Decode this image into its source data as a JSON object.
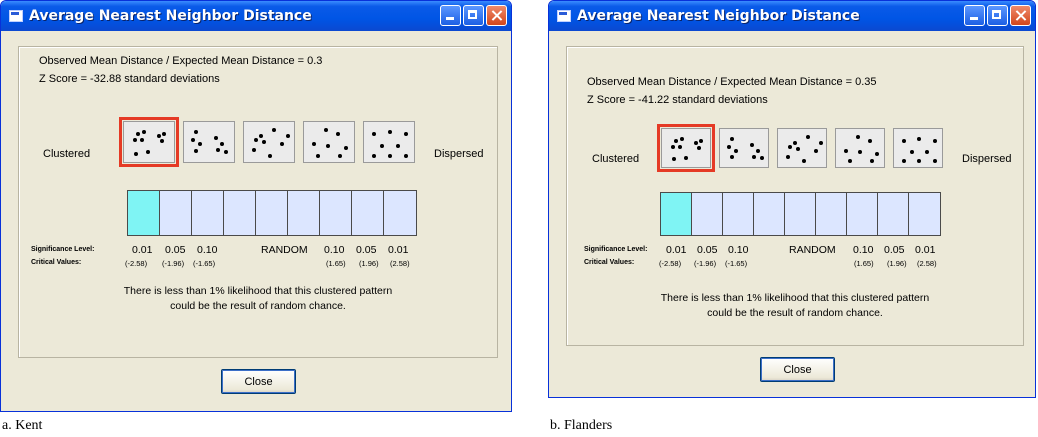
{
  "colors": {
    "selected_cell": "#7ff4f4",
    "cell": "#dce6ff",
    "highlight": "#e53a25",
    "titlebar": "#0055e5"
  },
  "panels": [
    {
      "window_title": "Average Nearest Neighbor Distance",
      "ratio_line": "Observed Mean Distance / Expected Mean Distance = 0.3",
      "z_line": "Z Score = -32.88 standard deviations",
      "clustered_label": "Clustered",
      "dispersed_label": "Dispersed",
      "significance_label": "Significance Level:",
      "critical_label": "Critical Values:",
      "sig_left": [
        "0.01",
        "0.05",
        "0.10"
      ],
      "crit_left": [
        "(-2.58)",
        "(-1.96)",
        "(-1.65)"
      ],
      "random_label": "RANDOM",
      "sig_right": [
        "0.10",
        "0.05",
        "0.01"
      ],
      "crit_right": [
        "(1.65)",
        "(1.96)",
        "(2.58)"
      ],
      "message_line1": "There is less than 1% likelihood that this clustered pattern",
      "message_line2": "could be the result of random chance.",
      "close_label": "Close",
      "selected_pattern_index": 0,
      "selected_cell_index": 0,
      "caption": "a. Kent",
      "titlebar_icons": [
        "minimize-icon",
        "maximize-icon",
        "close-icon"
      ]
    },
    {
      "window_title": "Average Nearest Neighbor Distance",
      "ratio_line": "Observed Mean Distance / Expected Mean Distance = 0.35",
      "z_line": "Z Score = -41.22 standard deviations",
      "clustered_label": "Clustered",
      "dispersed_label": "Dispersed",
      "significance_label": "Significance Level:",
      "critical_label": "Critical Values:",
      "sig_left": [
        "0.01",
        "0.05",
        "0.10"
      ],
      "crit_left": [
        "(-2.58)",
        "(-1.96)",
        "(-1.65)"
      ],
      "random_label": "RANDOM",
      "sig_right": [
        "0.10",
        "0.05",
        "0.01"
      ],
      "crit_right": [
        "(1.65)",
        "(1.96)",
        "(2.58)"
      ],
      "message_line1": "There is less than 1% likelihood that this clustered pattern",
      "message_line2": "could be the result of random chance.",
      "close_label": "Close",
      "selected_pattern_index": 0,
      "selected_cell_index": 0,
      "caption": "b. Flanders",
      "titlebar_icons": [
        "minimize-icon",
        "maximize-icon",
        "close-icon"
      ]
    }
  ]
}
